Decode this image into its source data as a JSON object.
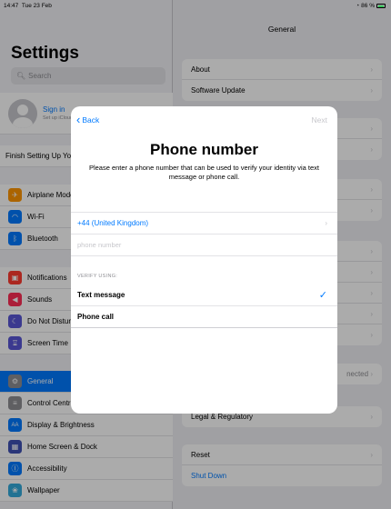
{
  "status_bar": {
    "time": "14:47",
    "date": "Tue 23 Feb",
    "battery": "86 %"
  },
  "sidebar": {
    "title": "Settings",
    "search_placeholder": "Search",
    "apple_id": {
      "label": "Sign in",
      "sublabel": "Set up iCloud"
    },
    "finish_setup": "Finish Setting Up Your iPad",
    "group1": [
      {
        "label": "Airplane Mode",
        "icon": "airplane-icon",
        "color": "#ff9500"
      },
      {
        "label": "Wi-Fi",
        "icon": "wifi-icon",
        "color": "#007aff"
      },
      {
        "label": "Bluetooth",
        "icon": "bluetooth-icon",
        "color": "#007aff"
      }
    ],
    "group2": [
      {
        "label": "Notifications",
        "icon": "notifications-icon",
        "color": "#ff3b30"
      },
      {
        "label": "Sounds",
        "icon": "sounds-icon",
        "color": "#ff2d55"
      },
      {
        "label": "Do Not Disturb",
        "icon": "moon-icon",
        "color": "#5856d6"
      },
      {
        "label": "Screen Time",
        "icon": "hourglass-icon",
        "color": "#5856d6"
      }
    ],
    "group3": [
      {
        "label": "General",
        "icon": "gear-icon",
        "color": "#8e8e93"
      },
      {
        "label": "Control Centre",
        "icon": "control-centre-icon",
        "color": "#8e8e93"
      },
      {
        "label": "Display & Brightness",
        "icon": "display-icon",
        "color": "#007aff"
      },
      {
        "label": "Home Screen & Dock",
        "icon": "home-screen-icon",
        "color": "#3f51b5"
      },
      {
        "label": "Accessibility",
        "icon": "accessibility-icon",
        "color": "#007aff"
      },
      {
        "label": "Wallpaper",
        "icon": "wallpaper-icon",
        "color": "#34aadc"
      }
    ]
  },
  "detail": {
    "title": "General",
    "group1": [
      "About",
      "Software Update"
    ],
    "connected_text": "nected",
    "legal": "Legal & Regulatory",
    "reset": "Reset",
    "shut_down": "Shut Down"
  },
  "modal": {
    "back_label": "Back",
    "next_label": "Next",
    "title": "Phone number",
    "description": "Please enter a phone number that can be used to verify your identity via text message or phone call.",
    "country": "+44 (United Kingdom)",
    "phone_placeholder": "phone number",
    "verify_label": "VERIFY USING:",
    "options": [
      "Text message",
      "Phone call"
    ],
    "selected_option": "Text message",
    "accent": "#007aff"
  }
}
